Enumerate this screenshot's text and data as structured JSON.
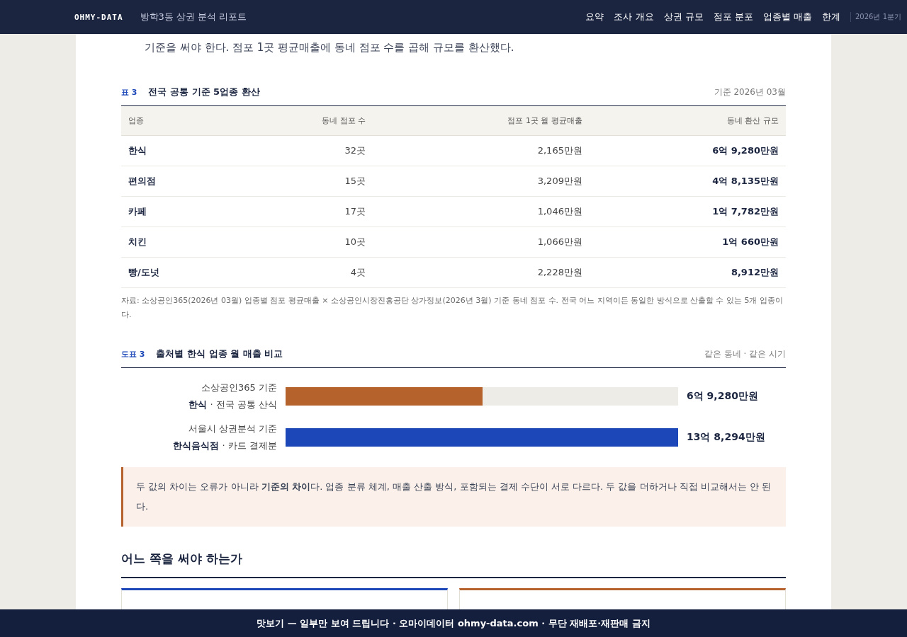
{
  "header": {
    "logo": "OHMY-DATA",
    "report_title": "방학3동 상권 분석 리포트",
    "nav": [
      {
        "label": "요약"
      },
      {
        "label": "조사 개요"
      },
      {
        "label": "상권 규모"
      },
      {
        "label": "점포 분포"
      },
      {
        "label": "업종별 매출"
      },
      {
        "label": "한계"
      }
    ],
    "period": "2026년 1분기"
  },
  "intro_text": "기준을 써야 한다. 점포 1곳 평균매출에 동네 점포 수를 곱해 규모를 환산했다.",
  "table": {
    "tag": "표 3",
    "title": "전국 공통 기준 5업종 환산",
    "note": "기준 2026년 03월",
    "columns": [
      "업종",
      "동네 점포 수",
      "점포 1곳 월 평균매출",
      "동네 환산 규모"
    ],
    "rows": [
      [
        "한식",
        "32곳",
        "2,165만원",
        "6억 9,280만원"
      ],
      [
        "편의점",
        "15곳",
        "3,209만원",
        "4억 8,135만원"
      ],
      [
        "카페",
        "17곳",
        "1,046만원",
        "1억 7,782만원"
      ],
      [
        "치킨",
        "10곳",
        "1,066만원",
        "1억 660만원"
      ],
      [
        "빵/도넛",
        "4곳",
        "2,228만원",
        "8,912만원"
      ]
    ],
    "source": "자료: 소상공인365(2026년 03월) 업종별 점포 평균매출 × 소상공인시장진흥공단 상가정보(2026년 3월) 기준 동네 점포 수. 전국 어느 지역이든 동일한 방식으로 산출할 수 있는 5개 업종이다."
  },
  "figure": {
    "tag": "도표 3",
    "title": "출처별 한식 업종 월 매출 비교",
    "note": "같은 동네 · 같은 시기",
    "bars": [
      {
        "source": "소상공인365 기준",
        "category": "한식",
        "basis": " · 전국 공통 산식",
        "color": "#b5622c",
        "level": 0.501,
        "value": "6억 9,280만원"
      },
      {
        "source": "서울시 상권분석 기준",
        "category": "한식음식점",
        "basis": " · 카드 결제분",
        "color": "#1c47b8",
        "level": 1,
        "value": "13억 8,294만원"
      }
    ]
  },
  "callout": "두 값의 차이는 오류가 아니라 **기준의 차이**다. 업종 분류 체계, 매출 산출 방식, 포함되는 결제 수단이 서로 다르다. 두 값을 더하거나 직접 비교해서는 안 된다.",
  "section_title": "어느 쪽을 써야 하는가",
  "cards": [
    {
      "color": "#1c47b8"
    },
    {
      "color": "#b5622c"
    }
  ],
  "banner": "맛보기 — 일부만 보여 드립니다 · 오마이데이터 ohmy-data.com · 무단 재배포·재판매 금지"
}
